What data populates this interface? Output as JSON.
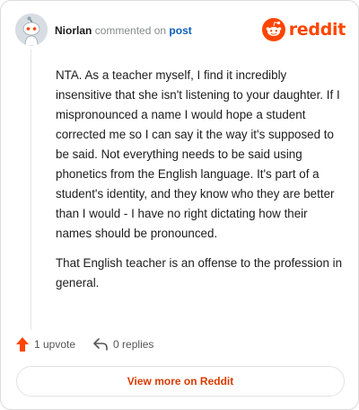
{
  "header": {
    "author": "Niorlan",
    "action_text": "commented on",
    "post_link": "post",
    "logo_text": "reddit",
    "brand_color": "#ff4500"
  },
  "comment": {
    "paragraphs": [
      "NTA. As a teacher myself, I find it incredibly insensitive that she isn't listening to your daughter. If I mispronounced a name I would hope a student corrected me so I can say it the way it's supposed to be said. Not everything needs to be said using phonetics from the English language. It's part of a student's identity, and they know who they are better than I would - I have no right dictating how their names should be pronounced.",
      "That English teacher is an offense to the profession in general."
    ]
  },
  "actions": {
    "upvote_label": "1 upvote",
    "upvote_icon": "arrow-up-icon",
    "reply_label": "0 replies",
    "reply_icon": "reply-icon"
  },
  "footer": {
    "view_button_label": "View more on Reddit"
  }
}
